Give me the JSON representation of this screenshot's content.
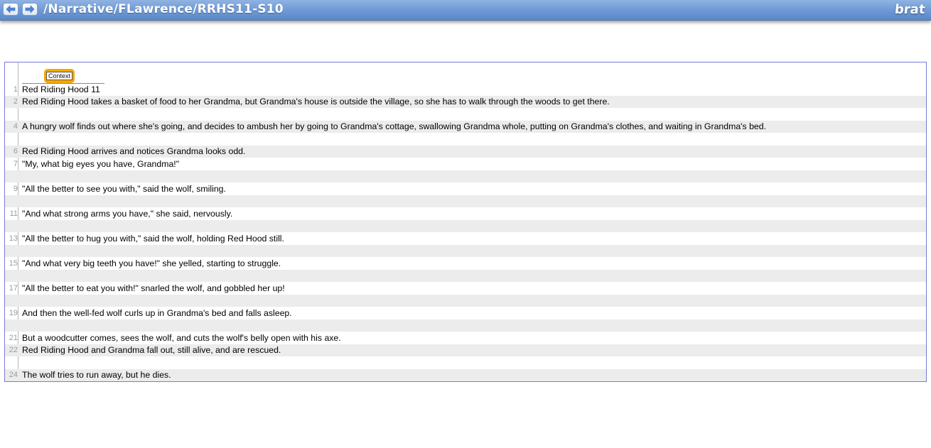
{
  "header": {
    "back_icon": "arrow-left-icon",
    "forward_icon": "arrow-right-icon",
    "document_path": "/Narrative/FLawrence/RRHS11-S10",
    "logo_text": "brat"
  },
  "annotation": {
    "label": "Context",
    "color": "#f7a700"
  },
  "lines": [
    {
      "num": "1",
      "text": "Red Riding Hood 11"
    },
    {
      "num": "2",
      "text": "Red Riding Hood takes a basket of food to her Grandma, but Grandma's house is outside the village, so she has to walk through the woods to get there."
    },
    {
      "num": "",
      "text": ""
    },
    {
      "num": "4",
      "text": "A hungry wolf finds out where she's going, and decides to ambush her by going to Grandma's cottage, swallowing Grandma whole, putting on Grandma's clothes, and waiting in Grandma's bed."
    },
    {
      "num": "",
      "text": ""
    },
    {
      "num": "6",
      "text": "Red Riding Hood arrives and notices Grandma looks odd."
    },
    {
      "num": "7",
      "text": "\"My, what big eyes you have, Grandma!\""
    },
    {
      "num": "",
      "text": ""
    },
    {
      "num": "9",
      "text": "\"All the better to see you with,\" said the wolf, smiling."
    },
    {
      "num": "",
      "text": ""
    },
    {
      "num": "11",
      "text": "\"And what strong arms you have,\" she said, nervously."
    },
    {
      "num": "",
      "text": ""
    },
    {
      "num": "13",
      "text": "\"All the better to hug you with,\" said the wolf, holding Red Hood still."
    },
    {
      "num": "",
      "text": ""
    },
    {
      "num": "15",
      "text": "\"And what very big teeth you have!\" she yelled, starting to struggle."
    },
    {
      "num": "",
      "text": ""
    },
    {
      "num": "17",
      "text": "\"All the better to eat you with!\" snarled the wolf, and gobbled her up!"
    },
    {
      "num": "",
      "text": ""
    },
    {
      "num": "19",
      "text": "And then the well-fed wolf curls up in Grandma's bed and falls asleep."
    },
    {
      "num": "",
      "text": ""
    },
    {
      "num": "21",
      "text": "But a woodcutter comes, sees the wolf, and cuts the wolf's belly open with his axe."
    },
    {
      "num": "22",
      "text": "Red Riding Hood and Grandma fall out, still alive, and are rescued."
    },
    {
      "num": "",
      "text": ""
    },
    {
      "num": "24",
      "text": "The wolf tries to run away, but he dies."
    }
  ]
}
